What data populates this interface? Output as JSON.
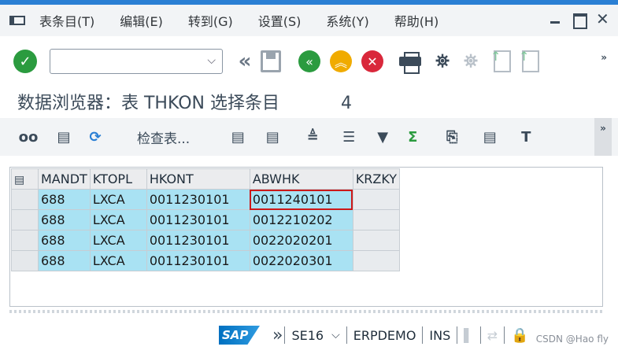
{
  "menu": {
    "items": [
      "表条目(T)",
      "编辑(E)",
      "转到(G)",
      "设置(S)",
      "系统(Y)",
      "帮助(H)"
    ]
  },
  "toolbar": {
    "command_value": "",
    "more_label": "»"
  },
  "title": {
    "text": "数据浏览器：表 THKON 选择条目",
    "count": "4"
  },
  "app_toolbar": {
    "check_table_label": "检查表...",
    "sum_symbol": "Σ",
    "more_label": "»"
  },
  "grid": {
    "columns": [
      "MANDT",
      "KTOPL",
      "HKONT",
      "ABWHK",
      "KRZKY"
    ],
    "rows": [
      [
        "688",
        "LXCA",
        "0011230101",
        "0011240101",
        ""
      ],
      [
        "688",
        "LXCA",
        "0011230101",
        "0012210202",
        ""
      ],
      [
        "688",
        "LXCA",
        "0011230101",
        "0022020201",
        ""
      ],
      [
        "688",
        "LXCA",
        "0011230101",
        "0022020301",
        ""
      ]
    ]
  },
  "status": {
    "logo": "SAP",
    "transaction": "SE16",
    "system": "ERPDEMO",
    "mode": "INS"
  },
  "watermark": "CSDN @Hao fly",
  "colors": {
    "accent_bar": "#2a7fd4",
    "row_highlight": "#a9e2f3",
    "ok_green": "#2b9b3f",
    "cancel_red": "#d9283b",
    "warn_yellow": "#f0ab00"
  }
}
